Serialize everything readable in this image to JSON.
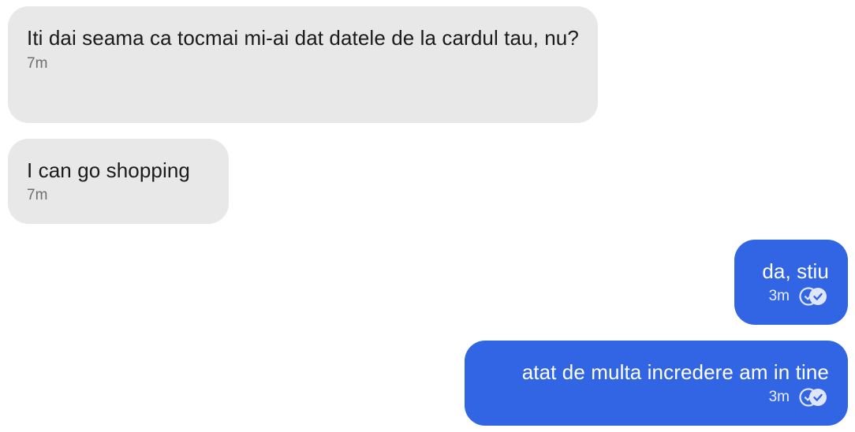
{
  "messages": [
    {
      "direction": "incoming",
      "text": "Iti dai seama ca tocmai mi-ai dat datele de la cardul tau, nu?",
      "time": "7m"
    },
    {
      "direction": "incoming",
      "text": "I can go shopping",
      "time": "7m"
    },
    {
      "direction": "outgoing",
      "text": "da, stiu",
      "time": "3m",
      "status_icon": "read-check-icon"
    },
    {
      "direction": "outgoing",
      "text": "atat de multa incredere am in tine",
      "time": "3m",
      "status_icon": "read-check-icon"
    }
  ],
  "colors": {
    "incoming_bubble": "#e8e8e8",
    "outgoing_bubble": "#3265e3",
    "incoming_text": "#1b1b1b",
    "outgoing_text": "#ffffff"
  }
}
